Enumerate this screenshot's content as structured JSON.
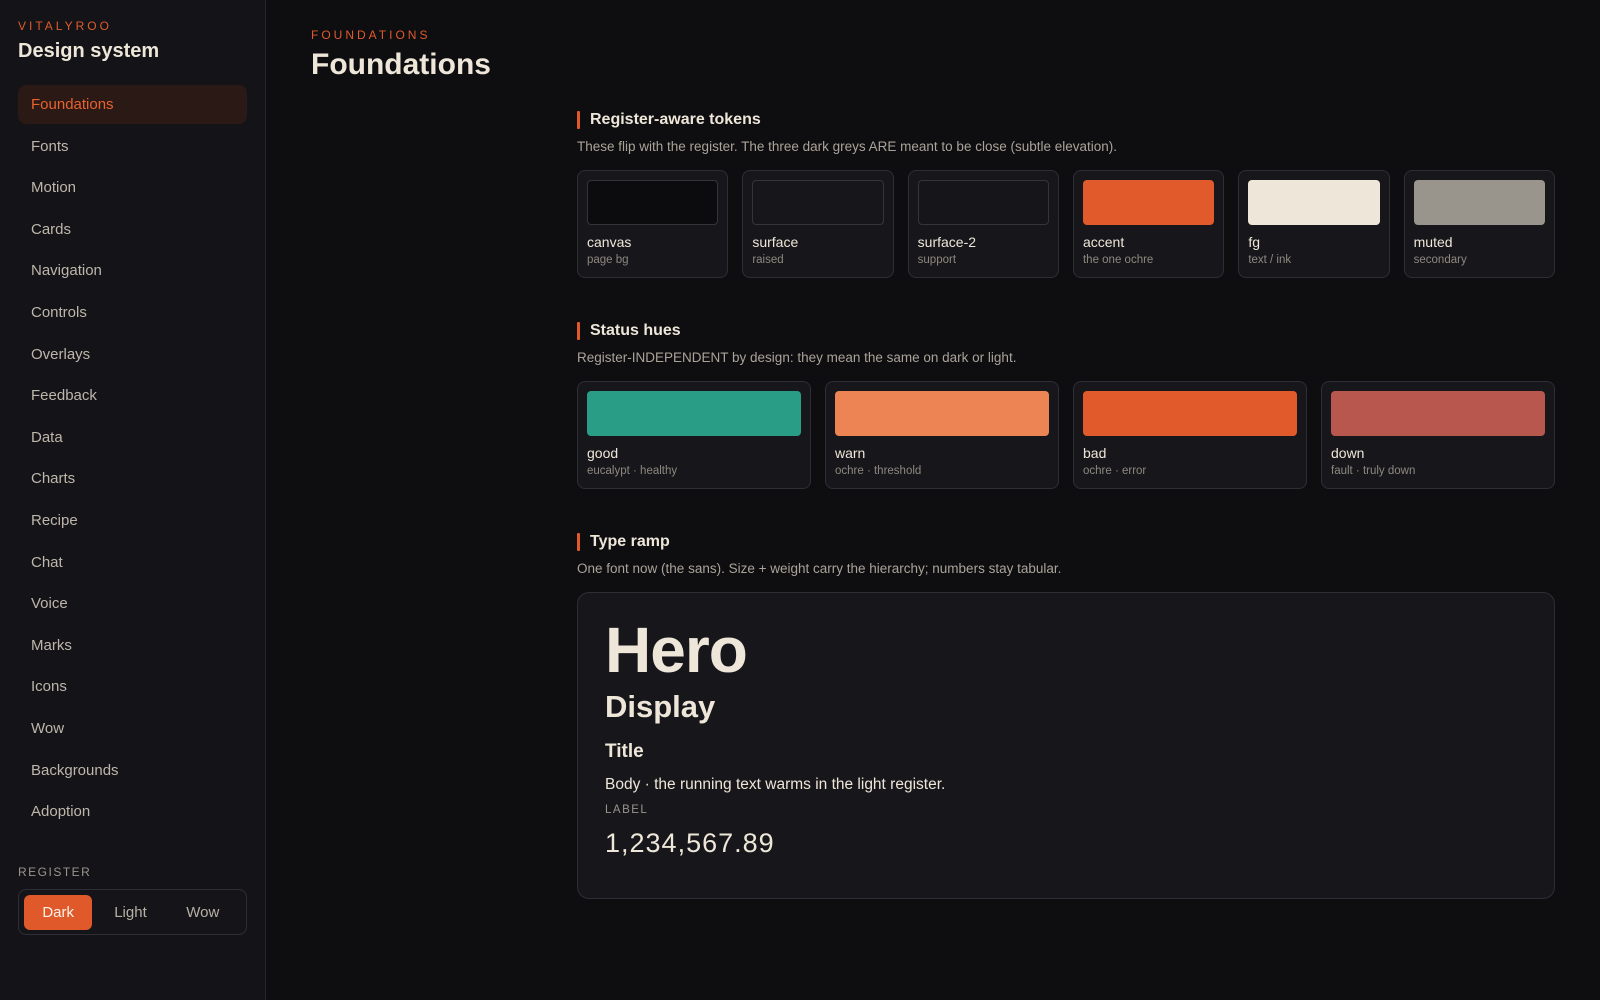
{
  "sidebar": {
    "brand_eyebrow": "VITALYROO",
    "brand_title": "Design system",
    "items": [
      {
        "label": "Foundations"
      },
      {
        "label": "Fonts"
      },
      {
        "label": "Motion"
      },
      {
        "label": "Cards"
      },
      {
        "label": "Navigation"
      },
      {
        "label": "Controls"
      },
      {
        "label": "Overlays"
      },
      {
        "label": "Feedback"
      },
      {
        "label": "Data"
      },
      {
        "label": "Charts"
      },
      {
        "label": "Recipe"
      },
      {
        "label": "Chat"
      },
      {
        "label": "Voice"
      },
      {
        "label": "Marks"
      },
      {
        "label": "Icons"
      },
      {
        "label": "Wow"
      },
      {
        "label": "Backgrounds"
      },
      {
        "label": "Adoption"
      }
    ],
    "active_item": "Foundations",
    "register": {
      "label": "REGISTER",
      "options": [
        "Dark",
        "Light",
        "Wow"
      ],
      "selected": "Dark"
    }
  },
  "main": {
    "eyebrow": "FOUNDATIONS",
    "title": "Foundations",
    "tokens": {
      "title": "Register-aware tokens",
      "description": "These flip with the register. The three dark greys ARE meant to be close (subtle elevation).",
      "swatches": [
        {
          "name": "canvas",
          "sub": "page bg",
          "color": "#0c0c0f"
        },
        {
          "name": "surface",
          "sub": "raised",
          "color": "#17171b"
        },
        {
          "name": "surface-2",
          "sub": "support",
          "color": "#16161a"
        },
        {
          "name": "accent",
          "sub": "the one ochre",
          "color": "#e05a2b"
        },
        {
          "name": "fg",
          "sub": "text / ink",
          "color": "#eee6d8"
        },
        {
          "name": "muted",
          "sub": "secondary",
          "color": "#9a958c"
        }
      ]
    },
    "status": {
      "title": "Status hues",
      "description": "Register-INDEPENDENT by design: they mean the same on dark or light.",
      "swatches": [
        {
          "name": "good",
          "sub": "eucalypt · healthy",
          "color": "#2a9d86"
        },
        {
          "name": "warn",
          "sub": "ochre · threshold",
          "color": "#ec8553"
        },
        {
          "name": "bad",
          "sub": "ochre · error",
          "color": "#e05a2b"
        },
        {
          "name": "down",
          "sub": "fault · truly down",
          "color": "#b7574e"
        }
      ]
    },
    "type_ramp": {
      "title": "Type ramp",
      "description": "One font now (the sans). Size + weight carry the hierarchy; numbers stay tabular.",
      "hero": "Hero",
      "display": "Display",
      "title_sample": "Title",
      "body": "Body · the running text warms in the light register.",
      "label": "LABEL",
      "number": "1,234,567.89"
    }
  }
}
